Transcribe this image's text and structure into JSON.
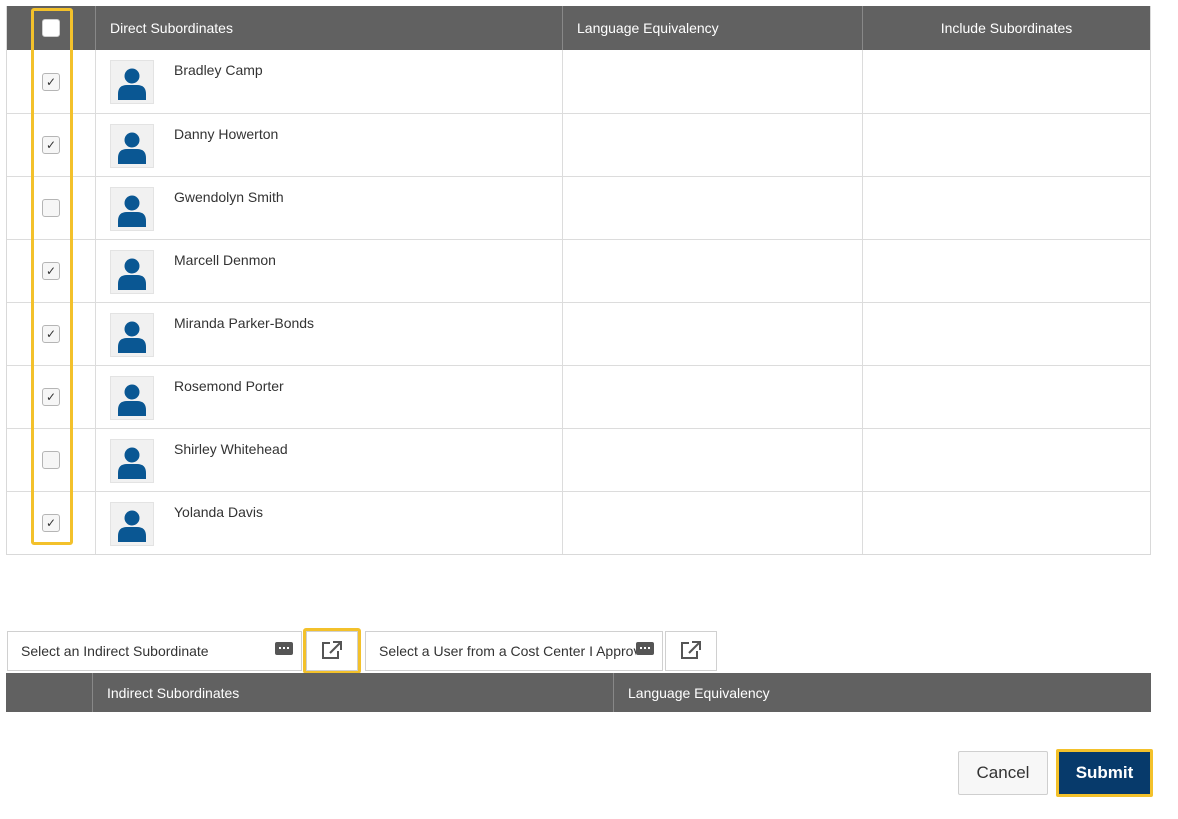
{
  "direct_table": {
    "columns": {
      "name": "Direct Subordinates",
      "language": "Language Equivalency",
      "include": "Include Subordinates"
    },
    "select_all_checked": false,
    "rows": [
      {
        "name": "Bradley Camp",
        "checked": true
      },
      {
        "name": "Danny Howerton",
        "checked": true
      },
      {
        "name": "Gwendolyn Smith",
        "checked": false
      },
      {
        "name": "Marcell Denmon",
        "checked": true
      },
      {
        "name": "Miranda Parker-Bonds",
        "checked": true
      },
      {
        "name": "Rosemond Porter",
        "checked": true
      },
      {
        "name": "Shirley Whitehead",
        "checked": false
      },
      {
        "name": "Yolanda Davis",
        "checked": true
      }
    ]
  },
  "indirect": {
    "select_indirect_placeholder": "Select an Indirect Subordinate",
    "select_cost_center_placeholder": "Select a User from a Cost Center I Approve",
    "columns": {
      "name": "Indirect Subordinates",
      "language": "Language Equivalency"
    }
  },
  "footer": {
    "cancel_label": "Cancel",
    "submit_label": "Submit"
  },
  "colors": {
    "header_bg": "#616161",
    "avatar_icon": "#0a5793",
    "highlight": "#f3c12b",
    "submit_bg": "#073a6b"
  }
}
